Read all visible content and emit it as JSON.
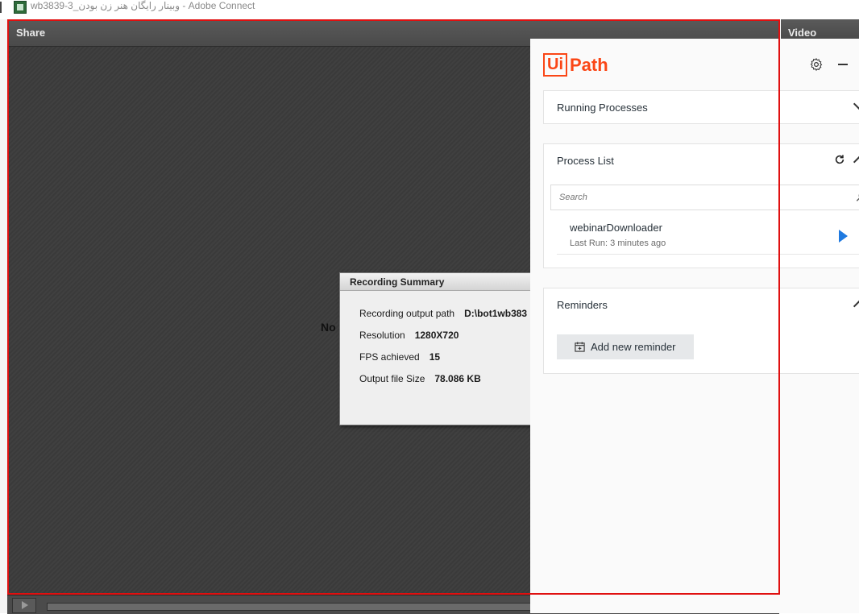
{
  "window": {
    "title": "wb3839-3_وبینار رایگان هنر زن بودن - Adobe Connect"
  },
  "share_pod": {
    "title": "Share",
    "content_note": "No"
  },
  "video_pod": {
    "title": "Video"
  },
  "recording_summary": {
    "title": "Recording Summary",
    "rows": [
      {
        "label": "Recording output path",
        "value": "D:\\bot1wb383"
      },
      {
        "label": "Resolution",
        "value": "1280X720"
      },
      {
        "label": "FPS achieved",
        "value": "15"
      },
      {
        "label": "Output file Size",
        "value": "78.086 KB"
      }
    ]
  },
  "uipath": {
    "logo_ui": "Ui",
    "logo_path": "Path",
    "icons": [
      "gear-icon",
      "minimize-icon",
      "refresh-icon",
      "search-icon",
      "play-icon",
      "calendar-icon"
    ],
    "accent_color": "#fa4616",
    "run_color": "#1f7ae0",
    "running_processes": {
      "title": "Running Processes"
    },
    "process_list": {
      "title": "Process List",
      "search_placeholder": "Search",
      "items": [
        {
          "name": "webinarDownloader",
          "last_run": "Last Run: 3 minutes ago"
        }
      ]
    },
    "reminders": {
      "title": "Reminders",
      "add_label": "Add new reminder"
    }
  },
  "highlight_color": "#e01010"
}
